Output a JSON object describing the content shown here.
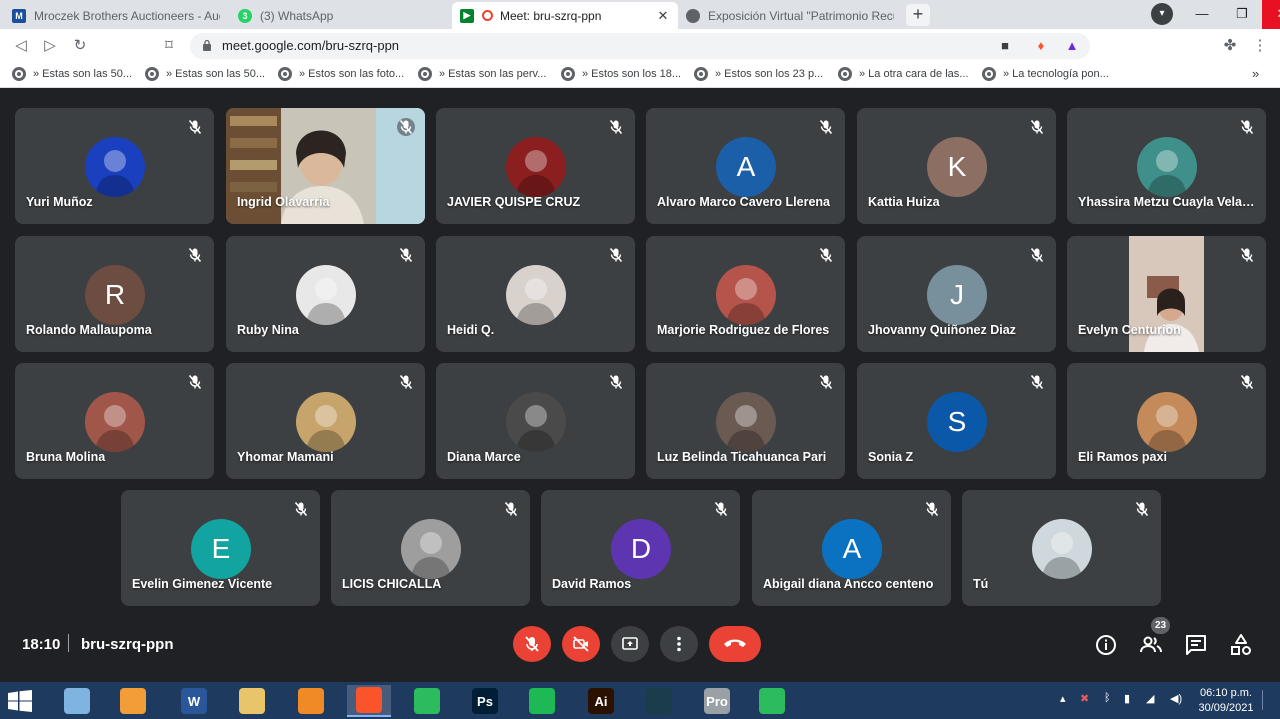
{
  "browser": {
    "tabs": [
      {
        "title": "Mroczek Brothers Auctioneers - Auction",
        "favicon": "auction-favicon",
        "active": false
      },
      {
        "title": "(3) WhatsApp",
        "favicon": "whatsapp-favicon",
        "active": false
      },
      {
        "title": "Meet: bru-szrq-ppn",
        "favicon": "meet-favicon",
        "active": true
      },
      {
        "title": "Exposición Virtual \"Patrimonio Recuperado\"",
        "favicon": "globe-favicon",
        "active": false
      }
    ],
    "new_tab_label": "+",
    "url": "meet.google.com/bru-szrq-ppn",
    "bookmarks": [
      "» Estas son las 50...",
      "» Estas son las 50...",
      "» Estos son las foto...",
      "» Estas son las perv...",
      "» Estos son los 18...",
      "» Estos son los 23 p...",
      "» La otra cara de las...",
      "» La tecnología pon..."
    ],
    "bookmarks_more": "»"
  },
  "meeting": {
    "time": "18:10",
    "code": "bru-szrq-ppn",
    "participant_count": "23",
    "participants": [
      {
        "name": "Yuri Muñoz",
        "kind": "photo",
        "color": "#1a3fbf"
      },
      {
        "name": "Ingrid Olavarria",
        "kind": "video",
        "color": "#b9b5a8"
      },
      {
        "name": "JAVIER QUISPE CRUZ",
        "kind": "photo",
        "color": "#8b1e1e"
      },
      {
        "name": "Alvaro Marco Cavero Llerena",
        "kind": "initial",
        "initial": "A",
        "color": "#1a5fa8"
      },
      {
        "name": "Kattia Huiza",
        "kind": "initial",
        "initial": "K",
        "color": "#8d6e63"
      },
      {
        "name": "Yhassira Metzu Cuayla Velasquez",
        "kind": "photo",
        "color": "#3f8f8a"
      },
      {
        "name": "Rolando Mallaupoma",
        "kind": "initial",
        "initial": "R",
        "color": "#6d4c41"
      },
      {
        "name": "Ruby Nina",
        "kind": "photo",
        "color": "#e8e8e8"
      },
      {
        "name": "Heidi Q.",
        "kind": "photo",
        "color": "#d9d2cc"
      },
      {
        "name": "Marjorie Rodriguez de Flores",
        "kind": "photo",
        "color": "#b5544a"
      },
      {
        "name": "Jhovanny Quiñonez Diaz",
        "kind": "initial",
        "initial": "J",
        "color": "#78909c"
      },
      {
        "name": "Evelyn Centurion",
        "kind": "video-narrow",
        "color": "#c9a99a"
      },
      {
        "name": "Bruna Molina",
        "kind": "photo",
        "color": "#a0574a"
      },
      {
        "name": "Yhomar Mamani",
        "kind": "photo",
        "color": "#c7a46b"
      },
      {
        "name": "Diana Marce",
        "kind": "photo",
        "color": "#4a4a4a"
      },
      {
        "name": "Luz Belinda Ticahuanca Pari",
        "kind": "photo",
        "color": "#6b5a52"
      },
      {
        "name": "Sonia Z",
        "kind": "initial",
        "initial": "S",
        "color": "#0b57a8"
      },
      {
        "name": "Eli Ramos paxi",
        "kind": "photo",
        "color": "#c48a5a"
      },
      {
        "name": "Evelin Gimenez Vicente",
        "kind": "initial",
        "initial": "E",
        "color": "#12a4a0"
      },
      {
        "name": "LICIS CHICALLA",
        "kind": "photo",
        "color": "#9e9e9e"
      },
      {
        "name": "David Ramos",
        "kind": "initial",
        "initial": "D",
        "color": "#5e35b1"
      },
      {
        "name": "Abigail diana Ancco centeno",
        "kind": "initial",
        "initial": "A",
        "color": "#0b72c2"
      },
      {
        "name": "Tú",
        "kind": "photo",
        "color": "#cfd8dc"
      }
    ]
  },
  "taskbar": {
    "time": "06:10 p.m.",
    "date": "30/09/2021",
    "apps": [
      "Explorer",
      "Media",
      "W",
      "Files",
      "VLC",
      "Brave",
      "Chat",
      "Ps",
      "Spotify",
      "Ai",
      "Filmora",
      "Pro",
      "Chat2"
    ]
  },
  "colors": {
    "meet_bg": "#202124",
    "tile_bg": "#3c4043",
    "danger": "#ea4335",
    "taskbar": "#1f3a5f"
  }
}
